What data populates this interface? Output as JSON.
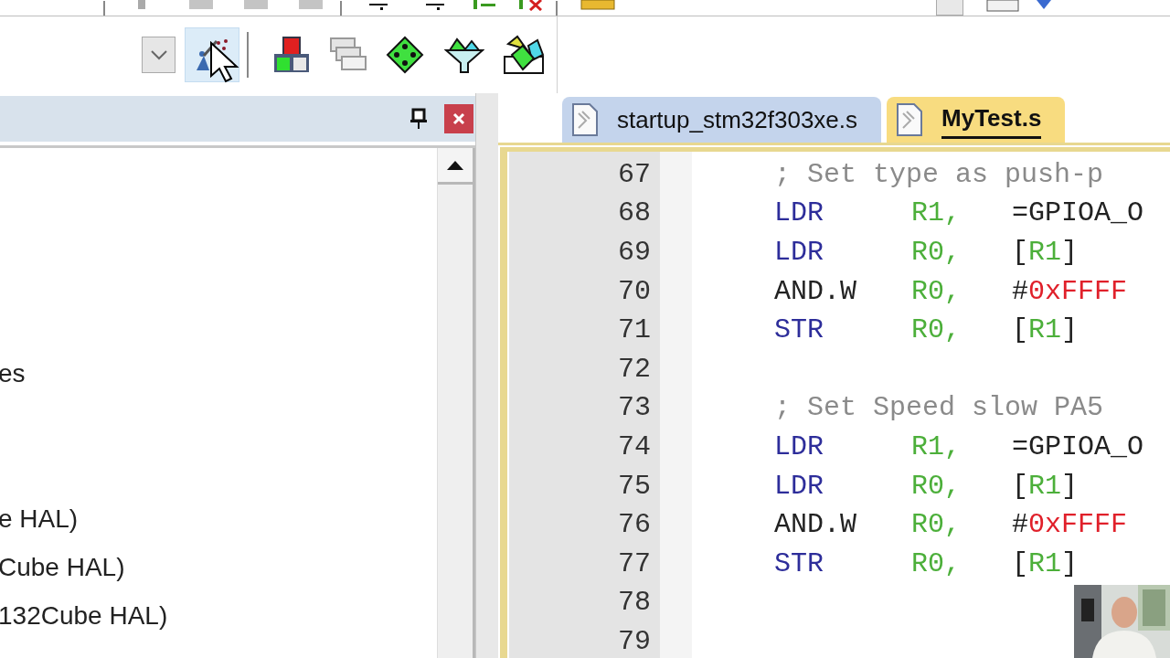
{
  "left_panel": {
    "items": [
      {
        "label": "es"
      },
      {
        "label": "e HAL)"
      },
      {
        "label": "Cube HAL)"
      },
      {
        "label": "132Cube HAL)"
      }
    ]
  },
  "tabs": [
    {
      "label": "startup_stm32f303xe.s",
      "selected": false
    },
    {
      "label": "MyTest.s",
      "selected": true
    }
  ],
  "editor": {
    "lines": [
      {
        "number": "67",
        "kind": "comment",
        "text": "; Set type as push-p"
      },
      {
        "number": "68",
        "kind": "instr",
        "mnemonic": "LDR",
        "register": "R1,",
        "operand": [
          {
            "text": "=GPIOA_O",
            "kind": "symbol"
          }
        ]
      },
      {
        "number": "69",
        "kind": "instr",
        "mnemonic": "LDR",
        "register": "R0,",
        "operand": [
          {
            "text": "[",
            "kind": "punct"
          },
          {
            "text": "R1",
            "kind": "reg"
          },
          {
            "text": "]",
            "kind": "punct"
          }
        ]
      },
      {
        "number": "70",
        "kind": "instr",
        "mnemonic": "AND.W",
        "register": "R0,",
        "operand": [
          {
            "text": "#",
            "kind": "punct"
          },
          {
            "text": "0xFFFF",
            "kind": "number"
          }
        ]
      },
      {
        "number": "71",
        "kind": "instr",
        "mnemonic": "STR",
        "register": "R0,",
        "operand": [
          {
            "text": "[",
            "kind": "punct"
          },
          {
            "text": "R1",
            "kind": "reg"
          },
          {
            "text": "]",
            "kind": "punct"
          }
        ]
      },
      {
        "number": "72",
        "kind": "blank"
      },
      {
        "number": "73",
        "kind": "comment",
        "text": "; Set Speed slow PA5"
      },
      {
        "number": "74",
        "kind": "instr",
        "mnemonic": "LDR",
        "register": "R1,",
        "operand": [
          {
            "text": "=GPIOA_O",
            "kind": "symbol"
          }
        ]
      },
      {
        "number": "75",
        "kind": "instr",
        "mnemonic": "LDR",
        "register": "R0,",
        "operand": [
          {
            "text": "[",
            "kind": "punct"
          },
          {
            "text": "R1",
            "kind": "reg"
          },
          {
            "text": "]",
            "kind": "punct"
          }
        ]
      },
      {
        "number": "76",
        "kind": "instr",
        "mnemonic": "AND.W",
        "register": "R0,",
        "operand": [
          {
            "text": "#",
            "kind": "punct"
          },
          {
            "text": "0xFFFF",
            "kind": "number"
          }
        ]
      },
      {
        "number": "77",
        "kind": "instr",
        "mnemonic": "STR",
        "register": "R0,",
        "operand": [
          {
            "text": "[",
            "kind": "punct"
          },
          {
            "text": "R1",
            "kind": "reg"
          },
          {
            "text": "]",
            "kind": "punct"
          }
        ]
      },
      {
        "number": "78",
        "kind": "blank"
      },
      {
        "number": "79",
        "kind": "blank"
      }
    ]
  }
}
